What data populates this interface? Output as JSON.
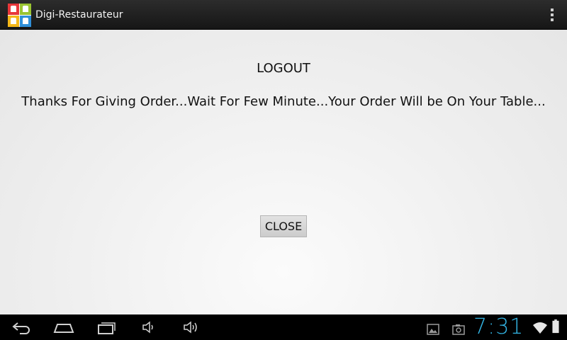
{
  "action_bar": {
    "title": "Digi-Restaurateur",
    "icon": "app-logo-icon",
    "menu_icon": "overflow-menu-icon",
    "logo_colors": [
      "#e8373a",
      "#9ac431",
      "#f4b719",
      "#2f8fd8"
    ]
  },
  "main": {
    "logout_label": "LOGOUT",
    "message": "Thanks For Giving Order...Wait For Few Minute...Your Order Will be On Your Table...",
    "close_label": "CLOSE"
  },
  "system_bar": {
    "nav_icons": [
      "back-icon",
      "home-icon",
      "recent-apps-icon",
      "volume-down-icon",
      "volume-up-icon"
    ],
    "status_icons": [
      "gallery-notification-icon",
      "screenshot-notification-icon",
      "wifi-icon",
      "battery-icon"
    ],
    "time": "7:31",
    "accent_color": "#33b5e5"
  }
}
